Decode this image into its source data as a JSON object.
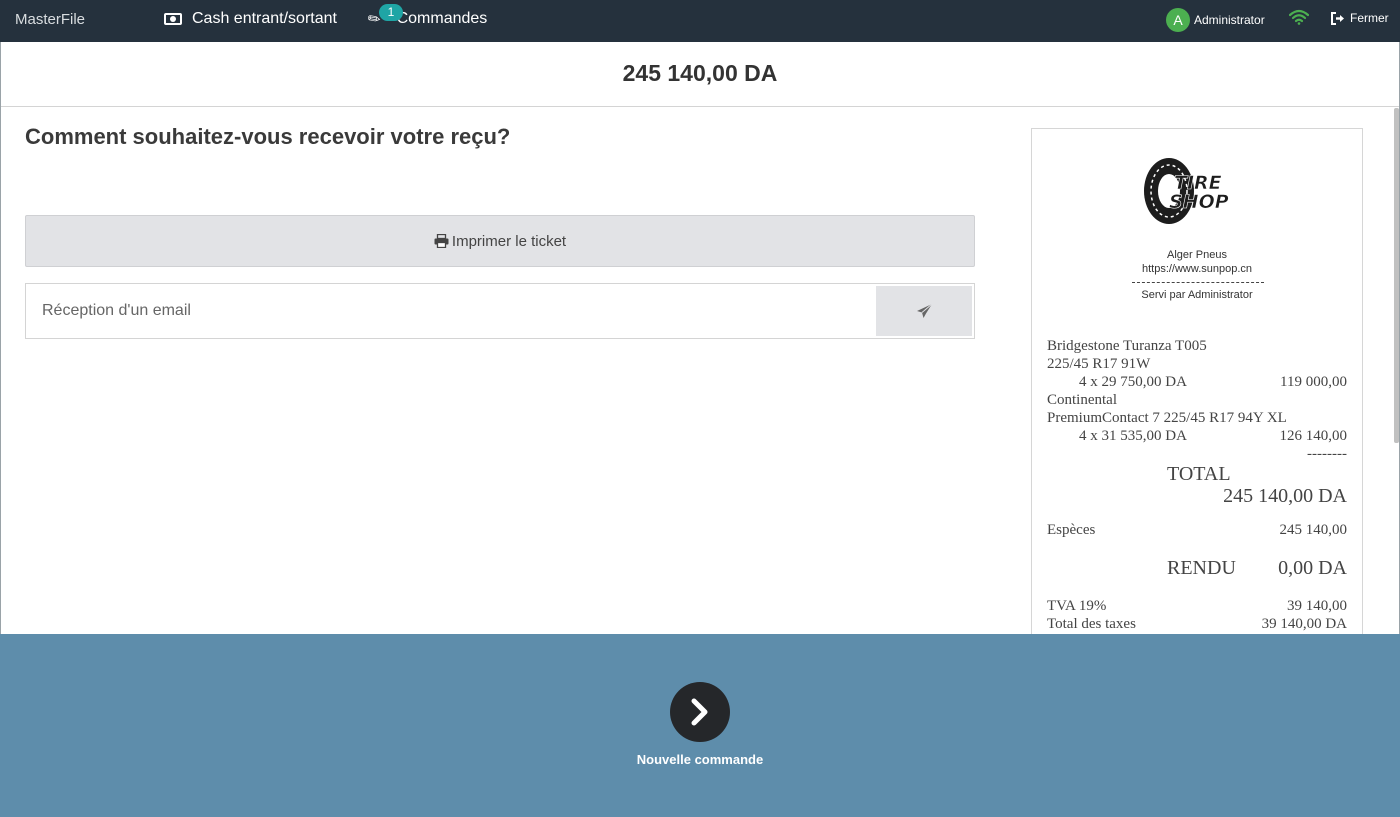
{
  "navbar": {
    "brand": "MasterFile",
    "cash_label": "Cash entrant/sortant",
    "orders_label": "Commandes",
    "orders_badge": "1",
    "user_initial": "A",
    "user_name": "Administrator",
    "close_label": "Fermer",
    "icons": [
      "cash-icon",
      "ticket-icon",
      "wifi-icon",
      "sign-out-icon"
    ]
  },
  "amount_due": "245 140,00 DA",
  "receipt_prompt": {
    "question": "Comment souhaitez-vous recevoir votre reçu?",
    "print_label": "Imprimer le ticket",
    "email_placeholder": "Réception d'un email"
  },
  "receipt": {
    "logo_text": [
      "TIRE",
      "SHOP"
    ],
    "shop_name": "Alger Pneus",
    "shop_url": "https://www.sunpop.cn",
    "served_by": "Servi par Administrator",
    "lines": [
      {
        "name_line1": "Bridgestone Turanza T005",
        "name_line2": "225/45 R17 91W",
        "qty_price": "4 x 29 750,00 DA",
        "amount": "119 000,00"
      },
      {
        "name_line1": "Continental",
        "name_line2": "PremiumContact 7 225/45 R17 94Y XL",
        "qty_price": "4 x 31 535,00 DA",
        "amount": "126 140,00"
      }
    ],
    "separator": "--------",
    "total_label": "TOTAL",
    "total_value": "245 140,00 DA",
    "payment_label": "Espèces",
    "payment_value": "245 140,00",
    "change_label": "RENDU",
    "change_value": "0,00 DA",
    "tax_label": "TVA 19%",
    "tax_value": "39 140,00",
    "total_tax_label": "Total des taxes",
    "total_tax_value": "39 140,00 DA"
  },
  "next_order_label": "Nouvelle commande",
  "colors": {
    "navbar": "#25313d",
    "bottom_panel": "#5e8dab",
    "badge": "#1fa5a5",
    "avatar": "#4caf50",
    "wifi": "#4caf50",
    "button_grey": "#e2e3e6"
  }
}
